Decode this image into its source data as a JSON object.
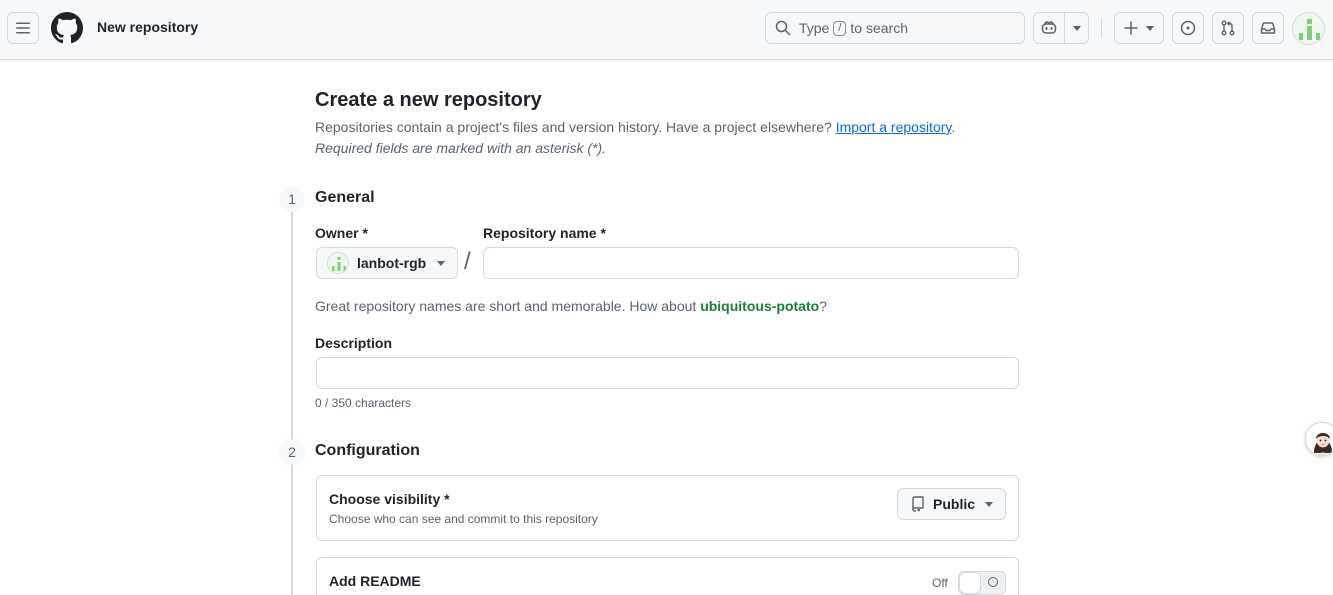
{
  "header": {
    "title": "New repository",
    "search": {
      "prefix": "Type",
      "key": "/",
      "suffix": "to search"
    }
  },
  "main": {
    "heading": "Create a new repository",
    "subtitle": "Repositories contain a project's files and version history. Have a project elsewhere?",
    "import_link": "Import a repository",
    "required_note": "Required fields are marked with an asterisk (*).",
    "general": {
      "step": "1",
      "title": "General",
      "owner_label": "Owner *",
      "owner_value": "lanbot-rgb",
      "slash": "/",
      "repo_name_label": "Repository name *",
      "repo_name_value": "",
      "hint_prefix": "Great repository names are short and memorable. How about",
      "suggestion": "ubiquitous-potato",
      "hint_suffix": "?",
      "description_label": "Description",
      "description_value": "",
      "char_count": "0 / 350 characters"
    },
    "configuration": {
      "step": "2",
      "title": "Configuration",
      "visibility_title": "Choose visibility *",
      "visibility_desc": "Choose who can see and commit to this repository",
      "visibility_value": "Public",
      "readme_title": "Add README",
      "readme_toggle_state": "Off"
    }
  },
  "colors": {
    "accent_link": "#0969da",
    "suggestion_green": "#1a7f37",
    "border": "#d1d9e0",
    "header_bg": "#f6f8fa"
  }
}
